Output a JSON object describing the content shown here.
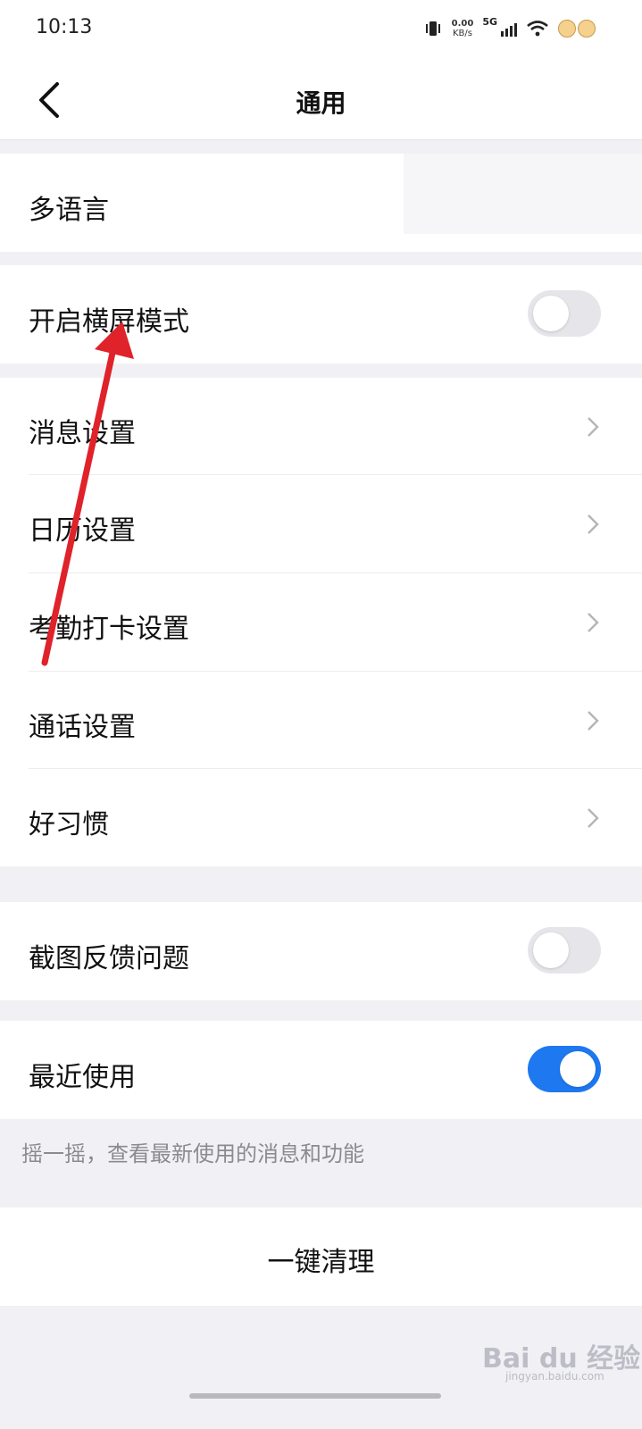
{
  "status_bar": {
    "time": "10:13",
    "net_speed_value": "0.00",
    "net_speed_unit": "KB/s",
    "network_type": "5G"
  },
  "header": {
    "title": "通用",
    "back_icon": "chevron-left-icon"
  },
  "rows": {
    "language": {
      "label": "多语言"
    },
    "landscape": {
      "label": "开启横屏模式",
      "toggle_on": false
    },
    "message": {
      "label": "消息设置"
    },
    "calendar": {
      "label": "日历设置"
    },
    "attendance": {
      "label": "考勤打卡设置"
    },
    "call": {
      "label": "通话设置"
    },
    "habit": {
      "label": "好习惯"
    },
    "screenshot_feedback": {
      "label": "截图反馈问题",
      "toggle_on": false
    },
    "recent": {
      "label": "最近使用",
      "toggle_on": true
    }
  },
  "hint": "摇一摇，查看最新使用的消息和功能",
  "clean_button": "一键清理",
  "annotation": {
    "type": "red-arrow",
    "color": "#e0222a"
  },
  "watermark": {
    "text": "Bai du 经验",
    "url": "jingyan.baidu.com"
  },
  "colors": {
    "accent": "#1e78f0",
    "background": "#f1f1f5",
    "toggle_off": "#e6e6ea"
  }
}
